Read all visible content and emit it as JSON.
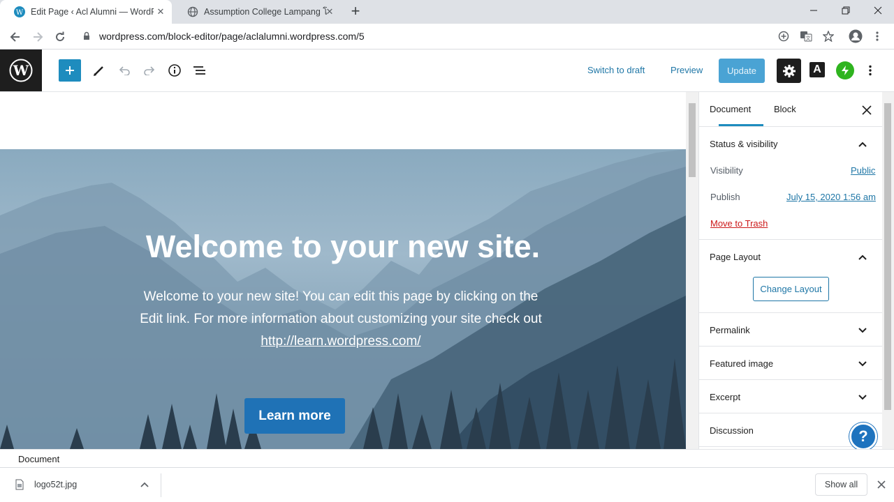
{
  "browser": {
    "tabs": [
      {
        "title": "Edit Page ‹ Acl Alumni — WordPress.com",
        "active": true
      },
      {
        "title": "Assumption College Lampang โรงเรียนอัสสัมชัญลำปาง",
        "active": false
      }
    ],
    "url": "wordpress.com/block-editor/page/aclalumni.wordpress.com/5"
  },
  "editor_header": {
    "switch_to_draft": "Switch to draft",
    "preview": "Preview",
    "update": "Update",
    "a_label": "A"
  },
  "hero": {
    "title": "Welcome to your new site.",
    "text": "Welcome to your new site! You can edit this page by clicking on the Edit link. For more information about customizing your site check out",
    "link": "http://learn.wordpress.com/",
    "button": "Learn more"
  },
  "sidebar": {
    "tabs": [
      "Document",
      "Block"
    ],
    "status_visibility": {
      "title": "Status & visibility",
      "visibility_label": "Visibility",
      "visibility_value": "Public",
      "publish_label": "Publish",
      "publish_value": "July 15, 2020 1:56 am",
      "trash": "Move to Trash"
    },
    "page_layout": {
      "title": "Page Layout",
      "button": "Change Layout"
    },
    "panels": [
      "Permalink",
      "Featured image",
      "Excerpt",
      "Discussion"
    ]
  },
  "footer": {
    "breadcrumb": "Document"
  },
  "downloads": {
    "file": "logo52t.jpg",
    "show_all": "Show all"
  },
  "colors": {
    "wp_blue": "#1e8cbe",
    "update_button": "#4aa3d4",
    "learn_more": "#1f72b6",
    "trash_red": "#cc1818",
    "jetpack_green": "#2fb41f"
  }
}
